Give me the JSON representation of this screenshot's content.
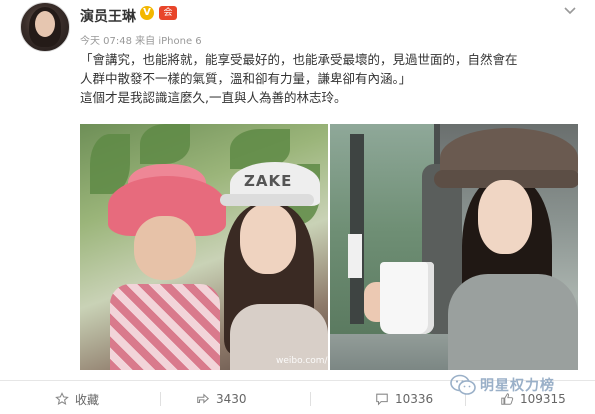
{
  "post": {
    "author": "演员王琳",
    "verified_badge": "V",
    "member_badge": "会",
    "meta": "今天 07:48 来自 iPhone 6",
    "text_lines": [
      "「會講究，也能將就，能享受最好的，也能承受最壞的，見過世面的，自然會在",
      "人群中散發不一樣的氣質，溫和卻有力量，謙卑卻有內涵。」",
      "這個才是我認識這麼久,一直與人為善的林志玲。"
    ],
    "photo_left": {
      "cap_text": "ZAKE",
      "watermark": "weibo.com/u/186"
    }
  },
  "actions": {
    "favorite_label": "收藏",
    "share_count": "3430",
    "comment_count": "10336",
    "like_count": "109315"
  },
  "brand": {
    "name": "明星权力榜",
    "color": "#9ab0c8"
  },
  "icons": [
    "avatar",
    "verified-icon",
    "member-icon",
    "chevron-down-icon",
    "star-icon",
    "share-icon",
    "comment-icon",
    "thumbs-up-icon",
    "wechat-icon"
  ]
}
